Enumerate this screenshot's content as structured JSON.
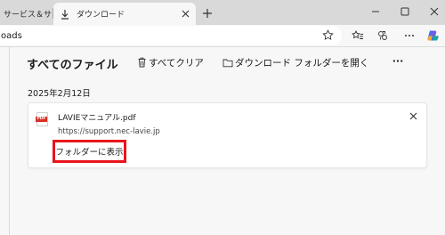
{
  "tabs": [
    {
      "label": "サービス＆サ",
      "active": false
    },
    {
      "label": "ダウンロード",
      "active": true
    }
  ],
  "address_bar": {
    "url_text": "oads"
  },
  "downloads": {
    "title": "すべてのファイル",
    "clear_all_label": "すべてクリア",
    "open_folder_label": "ダウンロード フォルダーを開く",
    "more_label": "···",
    "date_heading": "2025年2月12日",
    "items": [
      {
        "file_name": "LAVIEマニュアル.pdf",
        "source_url": "https://support.nec-lavie.jp",
        "file_type_badge": "PDF",
        "show_in_folder_label": "フォルダーに表示"
      }
    ]
  },
  "colors": {
    "highlight_border": "#e8141c",
    "pdf_badge": "#d93025",
    "tab_strip": "#d9d9d9",
    "page_background": "#f7f7f7"
  }
}
